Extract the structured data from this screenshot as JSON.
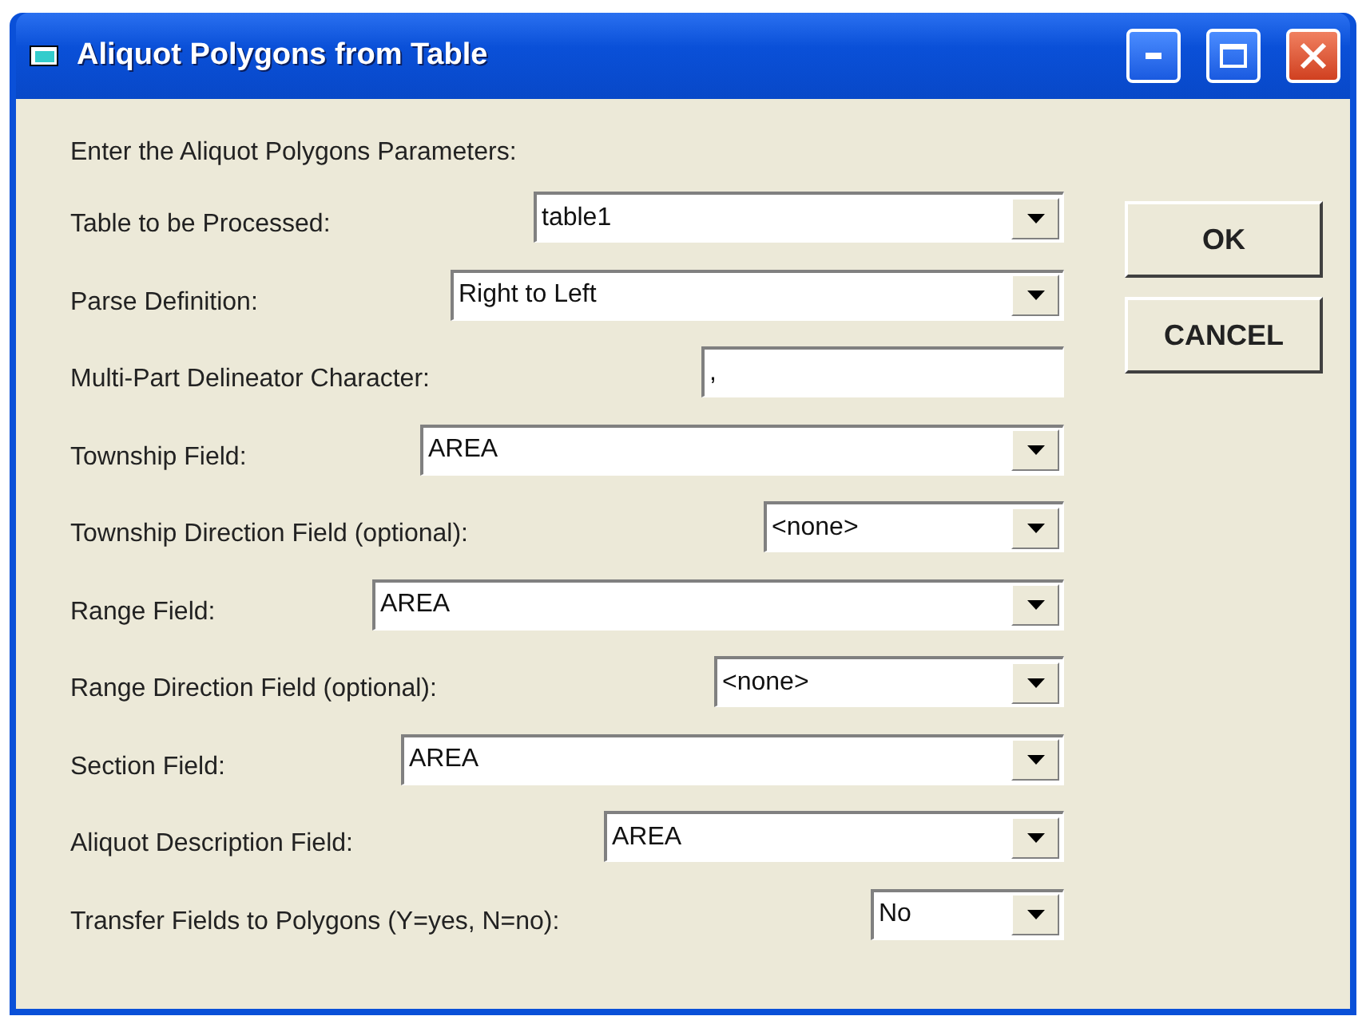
{
  "window": {
    "title": "Aliquot Polygons from Table"
  },
  "heading": "Enter the Aliquot Polygons Parameters:",
  "fields": [
    {
      "kind": "combo",
      "label": "Table to be Processed:",
      "value": "table1"
    },
    {
      "kind": "combo",
      "label": "Parse Definition:",
      "value": "Right to Left"
    },
    {
      "kind": "text",
      "label": "Multi-Part Delineator Character:",
      "value": ","
    },
    {
      "kind": "combo",
      "label": "Township Field:",
      "value": "AREA"
    },
    {
      "kind": "combo",
      "label": "Township Direction Field (optional):",
      "value": "<none>"
    },
    {
      "kind": "combo",
      "label": "Range Field:",
      "value": "AREA"
    },
    {
      "kind": "combo",
      "label": "Range Direction Field (optional):",
      "value": "<none>"
    },
    {
      "kind": "combo",
      "label": "Section Field:",
      "value": "AREA"
    },
    {
      "kind": "combo",
      "label": "Aliquot Description Field:",
      "value": "AREA"
    },
    {
      "kind": "combo",
      "label": "Transfer Fields to Polygons (Y=yes, N=no):",
      "value": "No"
    }
  ],
  "buttons": [
    "OK",
    "CANCEL"
  ]
}
